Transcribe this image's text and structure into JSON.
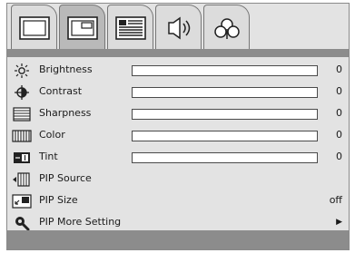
{
  "tabs": [
    {
      "icon": "picture-tab-icon",
      "active": false
    },
    {
      "icon": "pip-tab-icon",
      "active": true
    },
    {
      "icon": "options-tab-icon",
      "active": false
    },
    {
      "icon": "sound-tab-icon",
      "active": false
    },
    {
      "icon": "setup-tab-icon",
      "active": false
    }
  ],
  "menu": {
    "items": [
      {
        "label": "Brightness",
        "value": "0",
        "icon": "brightness-icon",
        "level": 0
      },
      {
        "label": "Contrast",
        "value": "0",
        "icon": "contrast-icon",
        "level": 0
      },
      {
        "label": "Sharpness",
        "value": "0",
        "icon": "sharpness-icon",
        "level": 0
      },
      {
        "label": "Color",
        "value": "0",
        "icon": "color-icon",
        "level": 0
      },
      {
        "label": "Tint",
        "value": "0",
        "icon": "tint-icon",
        "level": 0
      },
      {
        "label": "PIP Source",
        "value": "",
        "icon": "pip-source-icon"
      },
      {
        "label": "PIP Size",
        "value": "off",
        "icon": "pip-size-icon"
      },
      {
        "label": "PIP More Setting",
        "value": "▶",
        "icon": "pip-more-setting-icon"
      }
    ]
  },
  "colors": {
    "panel": "#e3e3e3",
    "bar": "#8c8c8c",
    "active_tab": "#b9b9b9"
  }
}
